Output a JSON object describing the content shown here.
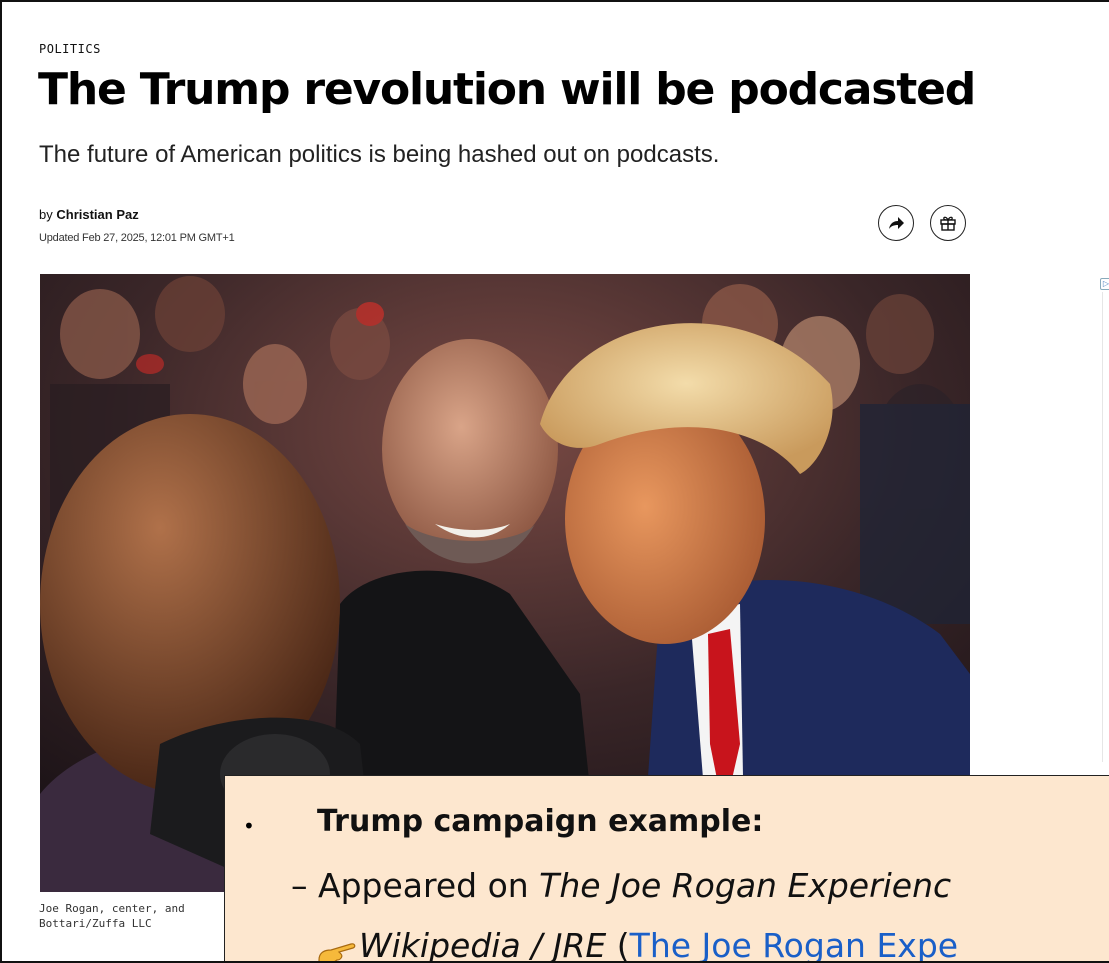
{
  "article": {
    "section": "POLITICS",
    "headline": "The Trump revolution will be podcasted",
    "dek": "The future of American politics is being hashed out on podcasts.",
    "byline_prefix": "by",
    "author": "Christian Paz",
    "updated": "Updated Feb 27, 2025, 12:01 PM GMT+1",
    "caption_line1": "Joe Rogan, center, and",
    "caption_line2": "Bottari/Zuffa LLC"
  },
  "actions": {
    "share_icon": "share-arrow-icon",
    "gift_icon": "gift-icon"
  },
  "callout": {
    "bullet": "•",
    "heading": "Trump campaign example:",
    "line2_prefix": "– Appeared on ",
    "line2_italic": "The Joe Rogan Experienc",
    "line3_italic": "Wikipedia / JRE",
    "line3_paren": " (",
    "line3_link": "The Joe Rogan Expe",
    "hand_icon": "pointing-hand-icon"
  },
  "colors": {
    "callout_bg": "#fde7cf",
    "link": "#1a5fc8"
  }
}
